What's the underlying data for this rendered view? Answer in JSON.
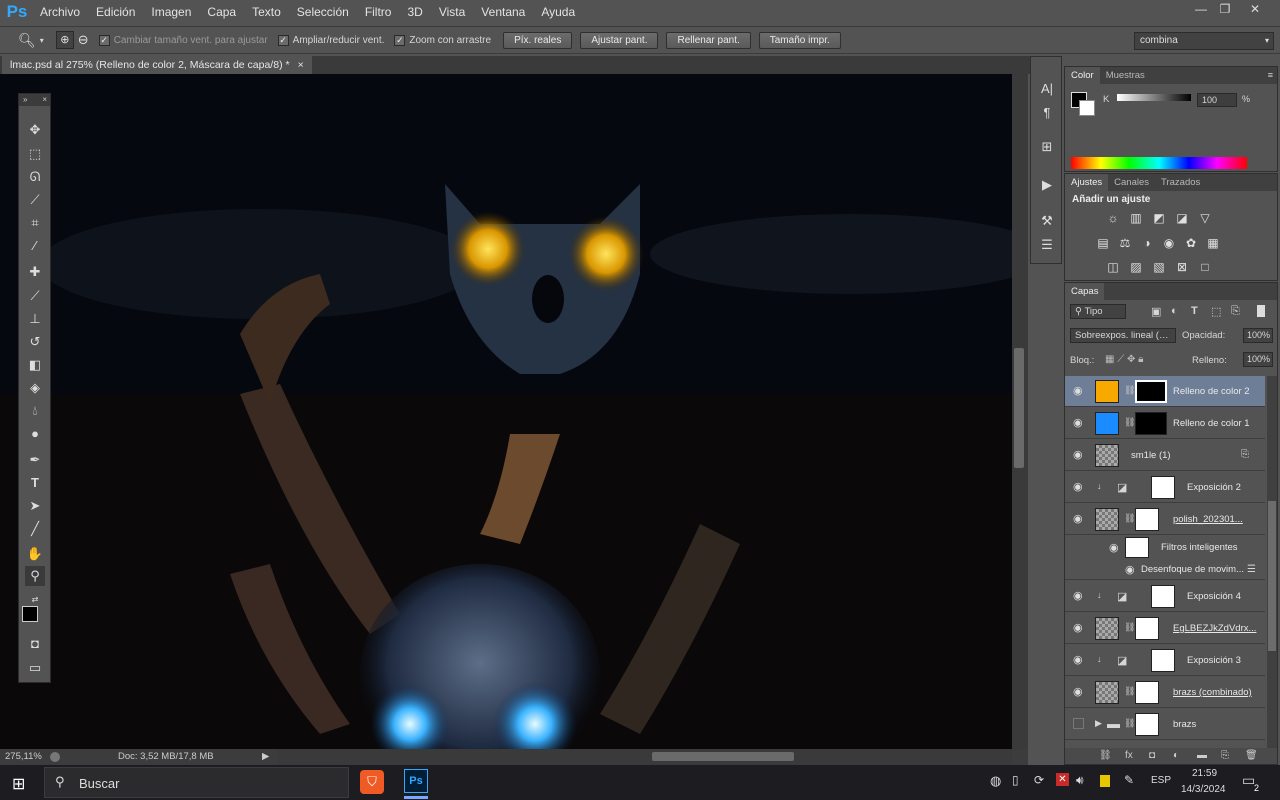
{
  "app": {
    "logo": "Ps"
  },
  "menu": [
    "Archivo",
    "Edición",
    "Imagen",
    "Capa",
    "Texto",
    "Selección",
    "Filtro",
    "3D",
    "Vista",
    "Ventana",
    "Ayuda"
  ],
  "window_controls": {
    "minimize": "—",
    "restore": "❐",
    "close": "✕"
  },
  "options": {
    "resize_windows": "Cambiar tamaño vent. para ajustar",
    "zoom_all": "Ampliar/reducir vent.",
    "scrubby_zoom": "Zoom con arrastre",
    "btn_actual": "Píx. reales",
    "btn_fit": "Ajustar pant.",
    "btn_fill": "Rellenar pant.",
    "btn_print": "Tamaño impr.",
    "workspace": "combina"
  },
  "document": {
    "tab_title": "lmac.psd al 275% (Relleno de color 2, Máscara de capa/8) *",
    "zoom": "275,11%",
    "doc_info": "Doc: 3,52 MB/17,8 MB"
  },
  "color_panel": {
    "tabs": [
      "Color",
      "Muestras"
    ],
    "channel": "K",
    "value": "100",
    "unit": "%"
  },
  "adjust_panel": {
    "tabs": [
      "Ajustes",
      "Canales",
      "Trazados"
    ],
    "heading": "Añadir un ajuste"
  },
  "layers_panel": {
    "tab": "Capas",
    "filter": "Tipo",
    "blend": "Sobreexpos. lineal (…",
    "opacity_label": "Opacidad:",
    "opacity": "100%",
    "lock_label": "Bloq.:",
    "fill_label": "Relleno:",
    "fill": "100%",
    "layers": [
      {
        "name": "Relleno de color 2",
        "color": "#f7a900",
        "selected": true
      },
      {
        "name": "Relleno de color 1",
        "color": "#1a8cff",
        "selected": false
      },
      {
        "name": "sm1le (1)"
      },
      {
        "name": "Exposición 2"
      },
      {
        "name": "polish_202301..."
      },
      {
        "name": "Filtros inteligentes"
      },
      {
        "name": "Desenfoque de movim..."
      },
      {
        "name": "Exposición 4"
      },
      {
        "name": "EgLBEZJkZdVdrx..."
      },
      {
        "name": "Exposición 3"
      },
      {
        "name": "brazs (combinado)"
      },
      {
        "name": "brazs"
      }
    ]
  },
  "taskbar": {
    "search": "Buscar",
    "lang": "ESP",
    "time": "21:59",
    "date": "14/3/2024",
    "notifications": "2"
  }
}
